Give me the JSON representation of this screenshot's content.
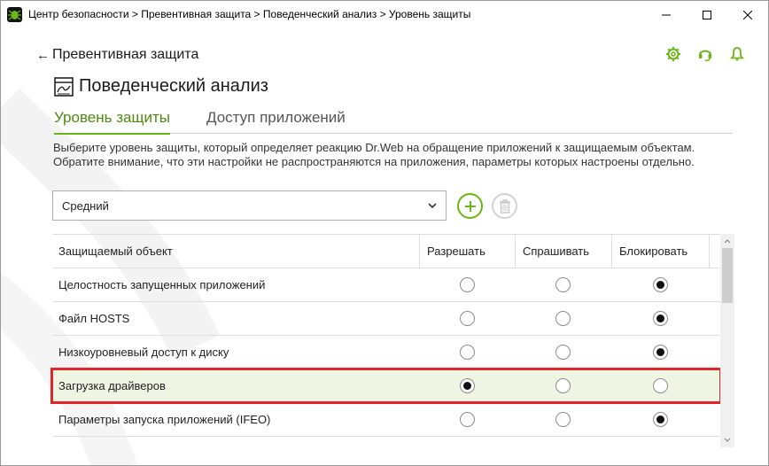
{
  "window": {
    "title": "Центр безопасности > Превентивная защита > Поведенческий анализ > Уровень защиты"
  },
  "header": {
    "back_label": "Превентивная защита",
    "section_title": "Поведенческий анализ"
  },
  "tabs": [
    {
      "label": "Уровень защиты",
      "active": true
    },
    {
      "label": "Доступ приложений",
      "active": false
    }
  ],
  "description": "Выберите уровень защиты, который определяет реакцию Dr.Web на обращение приложений к защищаемым объектам. Обратите внимание, что эти настройки не распространяются на приложения, параметры которых настроены отдельно.",
  "level_select": {
    "value": "Средний"
  },
  "table": {
    "columns": [
      "Защищаемый объект",
      "Разрешать",
      "Спрашивать",
      "Блокировать"
    ],
    "rows": [
      {
        "name": "Целостность запущенных приложений",
        "selected": "block"
      },
      {
        "name": "Файл HOSTS",
        "selected": "block"
      },
      {
        "name": "Низкоуровневый доступ к диску",
        "selected": "block"
      },
      {
        "name": "Загрузка драйверов",
        "selected": "allow",
        "highlighted": true
      },
      {
        "name": "Параметры запуска приложений (IFEO)",
        "selected": "block"
      }
    ]
  },
  "colors": {
    "accent_green": "#6cb516",
    "highlight_red": "#e3242b",
    "highlight_bg": "#eef5e3"
  },
  "icons": {
    "app": "drweb-spider-icon",
    "settings": "gear-icon",
    "support": "headset-icon",
    "notifications": "bell-icon",
    "section": "behavior-analysis-icon",
    "add": "plus-icon",
    "delete": "trash-icon"
  }
}
